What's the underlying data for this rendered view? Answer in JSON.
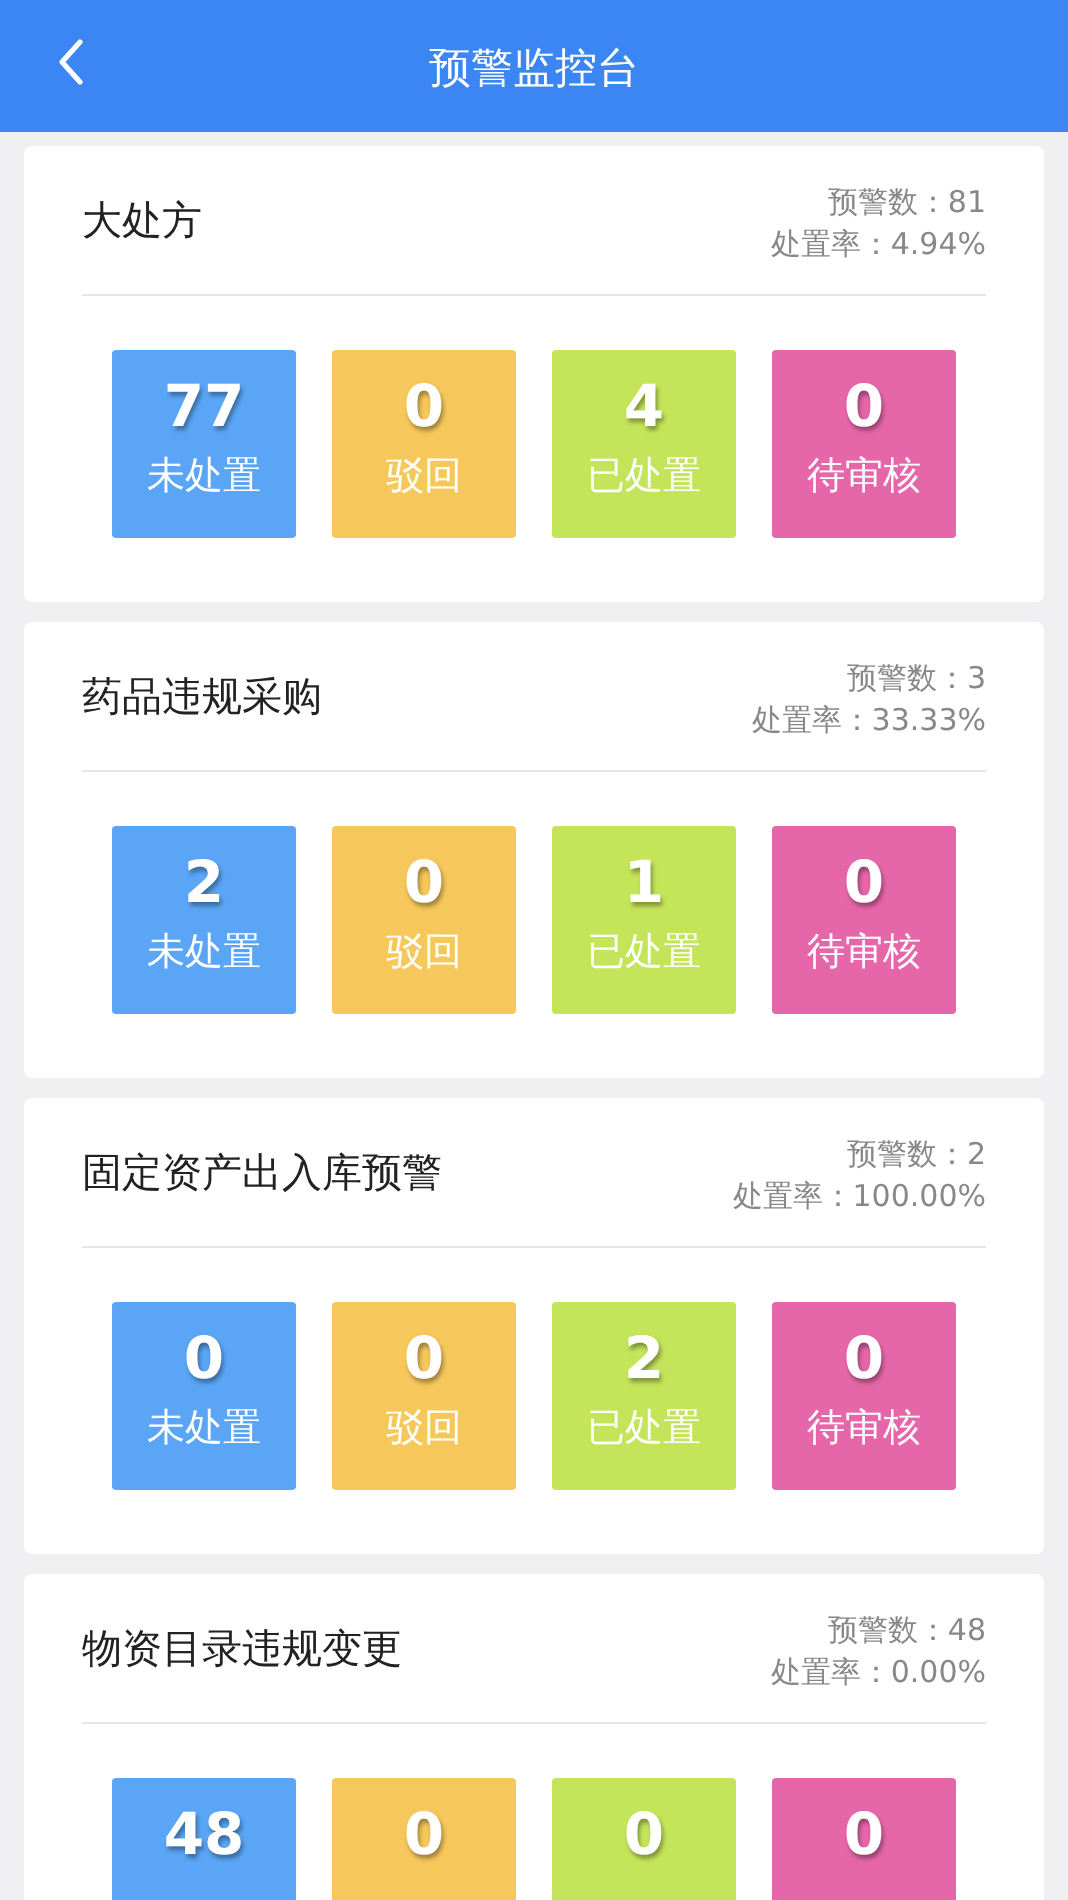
{
  "header": {
    "title": "预警监控台"
  },
  "cards": [
    {
      "title": "大处方",
      "alert_count": "预警数：81",
      "rate": "处置率：4.94%",
      "tiles": [
        {
          "value": "77",
          "label": "未处置",
          "color": "#5aa5f5"
        },
        {
          "value": "0",
          "label": "驳回",
          "color": "#f6c85b"
        },
        {
          "value": "4",
          "label": "已处置",
          "color": "#c4e45a"
        },
        {
          "value": "0",
          "label": "待审核",
          "color": "#e667a9"
        }
      ]
    },
    {
      "title": "药品违规采购",
      "alert_count": "预警数：3",
      "rate": "处置率：33.33%",
      "tiles": [
        {
          "value": "2",
          "label": "未处置",
          "color": "#5aa5f5"
        },
        {
          "value": "0",
          "label": "驳回",
          "color": "#f6c85b"
        },
        {
          "value": "1",
          "label": "已处置",
          "color": "#c4e45a"
        },
        {
          "value": "0",
          "label": "待审核",
          "color": "#e667a9"
        }
      ]
    },
    {
      "title": "固定资产出入库预警",
      "alert_count": "预警数：2",
      "rate": "处置率：100.00%",
      "tiles": [
        {
          "value": "0",
          "label": "未处置",
          "color": "#5aa5f5"
        },
        {
          "value": "0",
          "label": "驳回",
          "color": "#f6c85b"
        },
        {
          "value": "2",
          "label": "已处置",
          "color": "#c4e45a"
        },
        {
          "value": "0",
          "label": "待审核",
          "color": "#e667a9"
        }
      ]
    },
    {
      "title": "物资目录违规变更",
      "alert_count": "预警数：48",
      "rate": "处置率：0.00%",
      "tiles": [
        {
          "value": "48",
          "color": "#5aa5f5"
        },
        {
          "value": "0",
          "color": "#f6c85b"
        },
        {
          "value": "0",
          "color": "#c4e45a"
        },
        {
          "value": "0",
          "color": "#e667a9"
        }
      ]
    }
  ]
}
